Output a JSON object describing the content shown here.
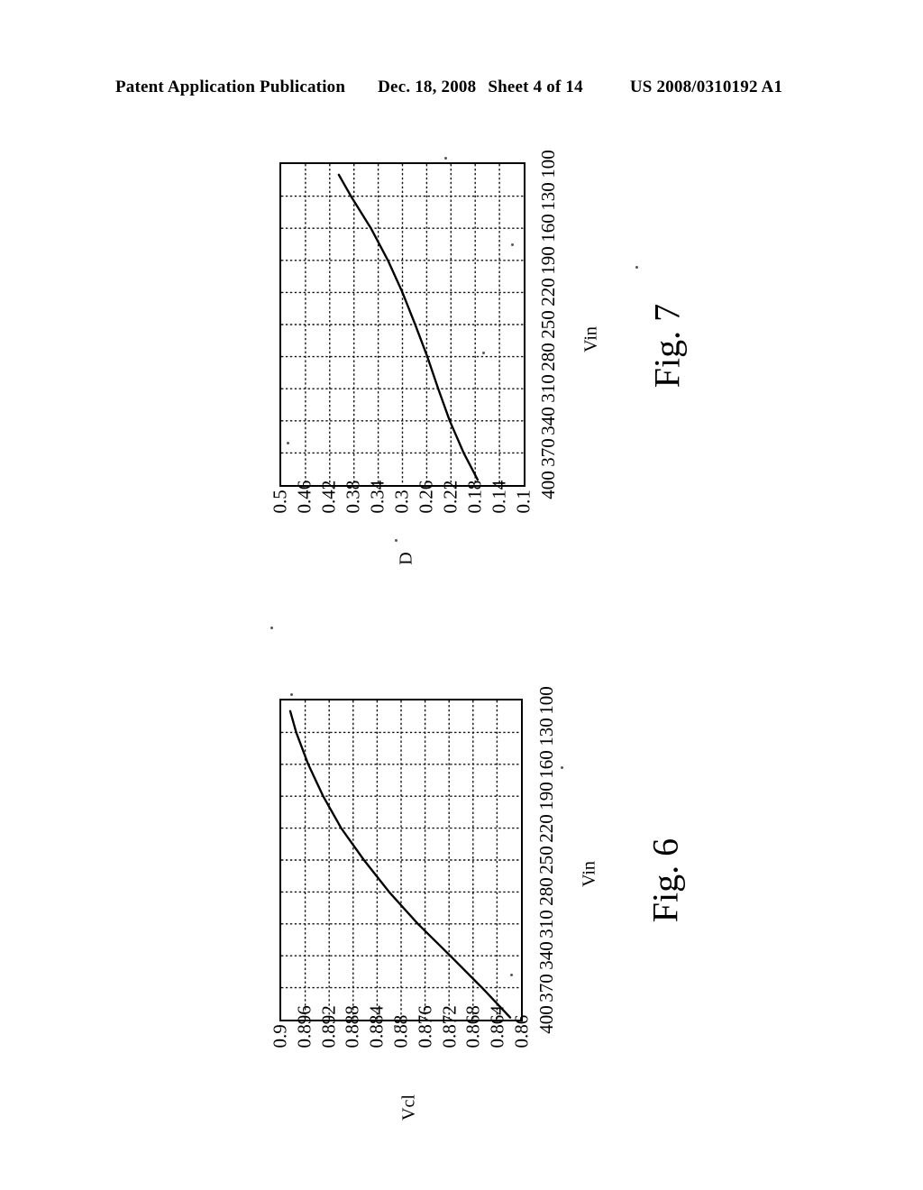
{
  "header": {
    "publication": "Patent Application Publication",
    "date": "Dec. 18, 2008",
    "sheet": "Sheet 4 of 14",
    "doc_number": "US 2008/0310192 A1"
  },
  "figures": [
    {
      "id": "figure-7",
      "caption": "Fig. 7",
      "x_axis_label": "Vin",
      "y_axis_label": "D"
    },
    {
      "id": "figure-6",
      "caption": "Fig. 6",
      "x_axis_label": "Vin",
      "y_axis_label": "Vcl"
    }
  ],
  "chart_data": [
    {
      "type": "line",
      "title": "Fig. 7",
      "xlabel": "Vin",
      "ylabel": "D",
      "orientation": "rotated-90-ccw",
      "grid": true,
      "legend": "none",
      "xlim": [
        100,
        400
      ],
      "ylim": [
        0.1,
        0.5
      ],
      "xticks": [
        100,
        130,
        160,
        190,
        220,
        250,
        280,
        310,
        340,
        370,
        400
      ],
      "yticks": [
        0.1,
        0.14,
        0.18,
        0.22,
        0.26,
        0.3,
        0.34,
        0.38,
        0.42,
        0.46,
        0.5
      ],
      "ytick_labels_display_order": [
        "0.5",
        "0.46",
        "0.42",
        "0.38",
        "0.34",
        "0.3",
        "0.26",
        "0.22",
        "0.18",
        "0.14",
        "0.1"
      ],
      "xtick_labels_display_order": [
        "100",
        "130",
        "160",
        "190",
        "220",
        "250",
        "280",
        "310",
        "340",
        "370",
        "400"
      ],
      "series": [
        {
          "name": "D",
          "x": [
            110,
            130,
            160,
            190,
            220,
            250,
            280,
            310,
            340,
            370,
            395
          ],
          "y": [
            0.405,
            0.385,
            0.352,
            0.324,
            0.3,
            0.279,
            0.259,
            0.241,
            0.222,
            0.199,
            0.176
          ]
        }
      ]
    },
    {
      "type": "line",
      "title": "Fig. 6",
      "xlabel": "Vin",
      "ylabel": "Vcl",
      "orientation": "rotated-90-ccw",
      "grid": true,
      "legend": "none",
      "xlim": [
        100,
        400
      ],
      "ylim": [
        0.86,
        0.9
      ],
      "xticks": [
        100,
        130,
        160,
        190,
        220,
        250,
        280,
        310,
        340,
        370,
        400
      ],
      "yticks": [
        0.86,
        0.864,
        0.868,
        0.872,
        0.876,
        0.88,
        0.884,
        0.888,
        0.892,
        0.896,
        0.9
      ],
      "ytick_labels_display_order": [
        "0.9",
        "0.896",
        "0.892",
        "0.888",
        "0.884",
        "0.88",
        "0.876",
        "0.872",
        "0.868",
        "0.864",
        "0.86"
      ],
      "xtick_labels_display_order": [
        "100",
        "130",
        "160",
        "190",
        "220",
        "250",
        "280",
        "310",
        "340",
        "370",
        "400"
      ],
      "series": [
        {
          "name": "Vcl",
          "x": [
            110,
            130,
            160,
            190,
            220,
            250,
            280,
            310,
            340,
            370,
            398
          ],
          "y": [
            0.8985,
            0.8975,
            0.8955,
            0.893,
            0.89,
            0.8862,
            0.882,
            0.8772,
            0.8718,
            0.8665,
            0.8618
          ]
        }
      ]
    }
  ]
}
